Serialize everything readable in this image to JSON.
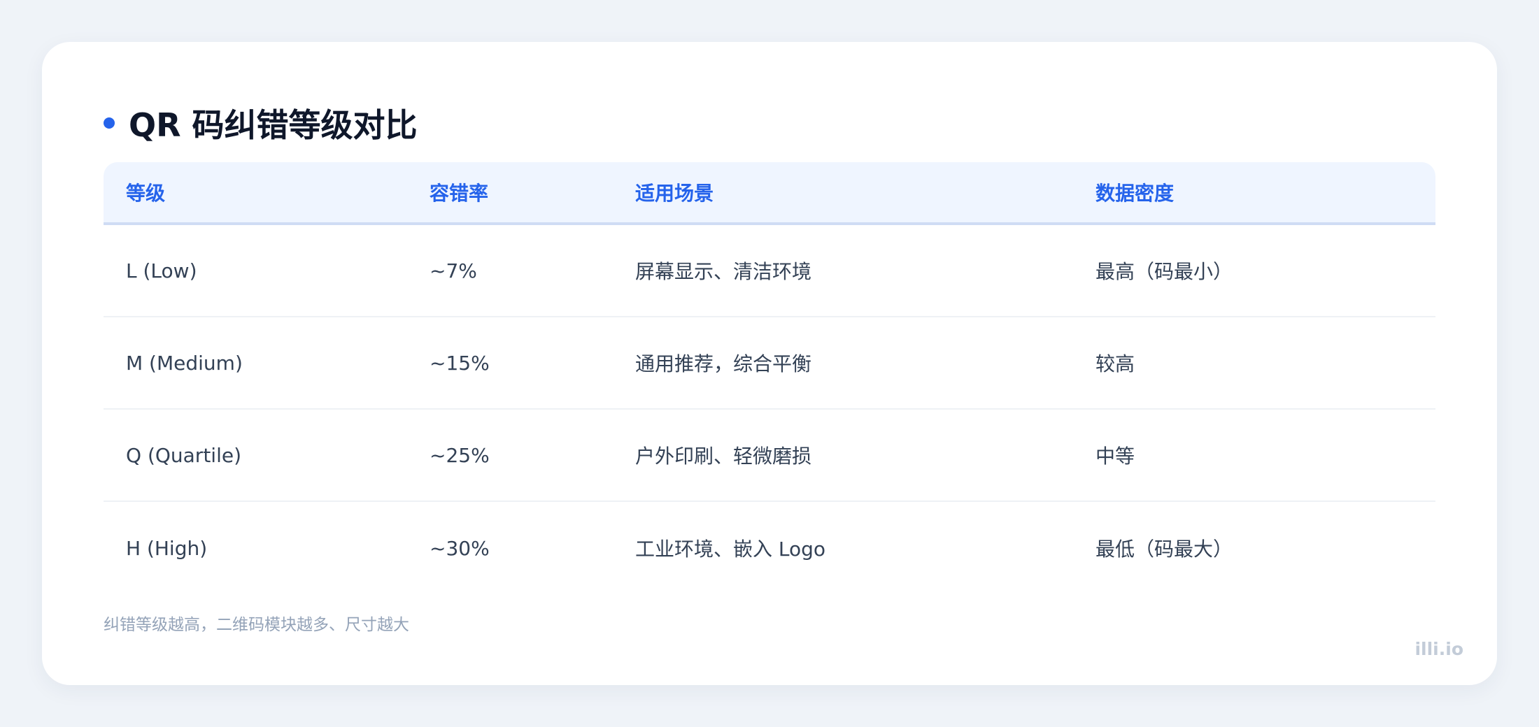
{
  "title": "QR 码纠错等级对比",
  "colors": {
    "accent": "#2563eb",
    "page_bg": "#eff3f8",
    "header_bg": "#eff5ff"
  },
  "table": {
    "headers": [
      "等级",
      "容错率",
      "适用场景",
      "数据密度"
    ],
    "rows": [
      [
        "L (Low)",
        "~7%",
        "屏幕显示、清洁环境",
        "最高（码最小）"
      ],
      [
        "M (Medium)",
        "~15%",
        "通用推荐，综合平衡",
        "较高"
      ],
      [
        "Q (Quartile)",
        "~25%",
        "户外印刷、轻微磨损",
        "中等"
      ],
      [
        "H (High)",
        "~30%",
        "工业环境、嵌入 Logo",
        "最低（码最大）"
      ]
    ]
  },
  "footnote": "纠错等级越高，二维码模块越多、尺寸越大",
  "brand": "illi.io"
}
